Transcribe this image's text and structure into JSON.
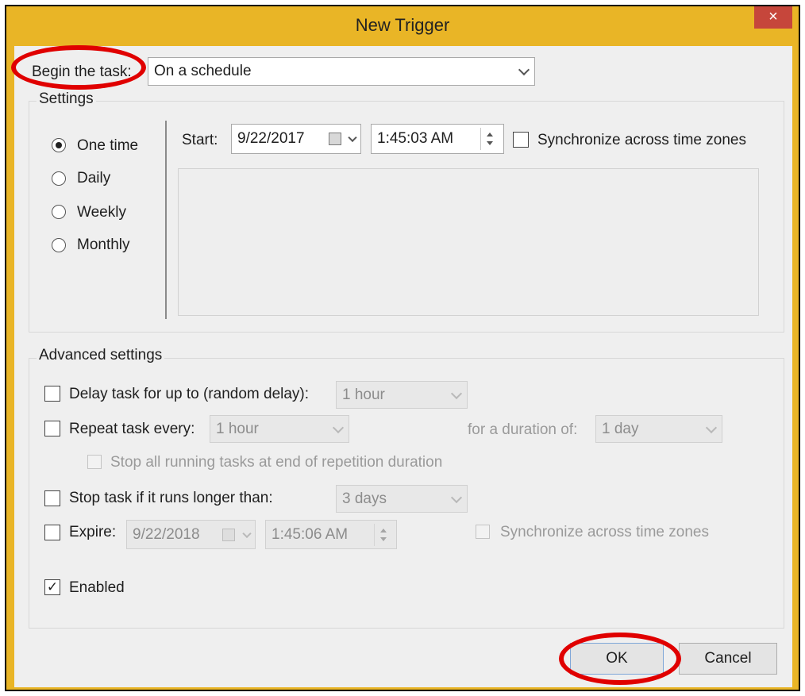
{
  "window": {
    "title": "New Trigger",
    "close_glyph": "×",
    "accent_color": "#e9b526",
    "close_color": "#c6463b"
  },
  "begin": {
    "label": "Begin the task:",
    "value": "On a schedule"
  },
  "settings": {
    "legend": "Settings",
    "schedule_options": [
      {
        "label": "One time",
        "selected": true
      },
      {
        "label": "Daily",
        "selected": false
      },
      {
        "label": "Weekly",
        "selected": false
      },
      {
        "label": "Monthly",
        "selected": false
      }
    ],
    "start_label": "Start:",
    "start_date": "9/22/2017",
    "start_time": "1:45:03 AM",
    "sync_label": "Synchronize across time zones",
    "sync_checked": false
  },
  "advanced": {
    "legend": "Advanced settings",
    "delay": {
      "label": "Delay task for up to (random delay):",
      "value": "1 hour",
      "checked": false
    },
    "repeat": {
      "label": "Repeat task every:",
      "value": "1 hour",
      "checked": false,
      "duration_label": "for a duration of:",
      "duration_value": "1 day"
    },
    "stop_all": {
      "label": "Stop all running tasks at end of repetition duration",
      "checked": false
    },
    "stop_longer": {
      "label": "Stop task if it runs longer than:",
      "value": "3 days",
      "checked": false
    },
    "expire": {
      "label": "Expire:",
      "date": "9/22/2018",
      "time": "1:45:06 AM",
      "checked": false,
      "sync_label": "Synchronize across time zones"
    },
    "enabled": {
      "label": "Enabled",
      "checked": true,
      "check_glyph": "✓"
    }
  },
  "buttons": {
    "ok": "OK",
    "cancel": "Cancel"
  },
  "annotations": {
    "highlight_color": "#e00000"
  }
}
